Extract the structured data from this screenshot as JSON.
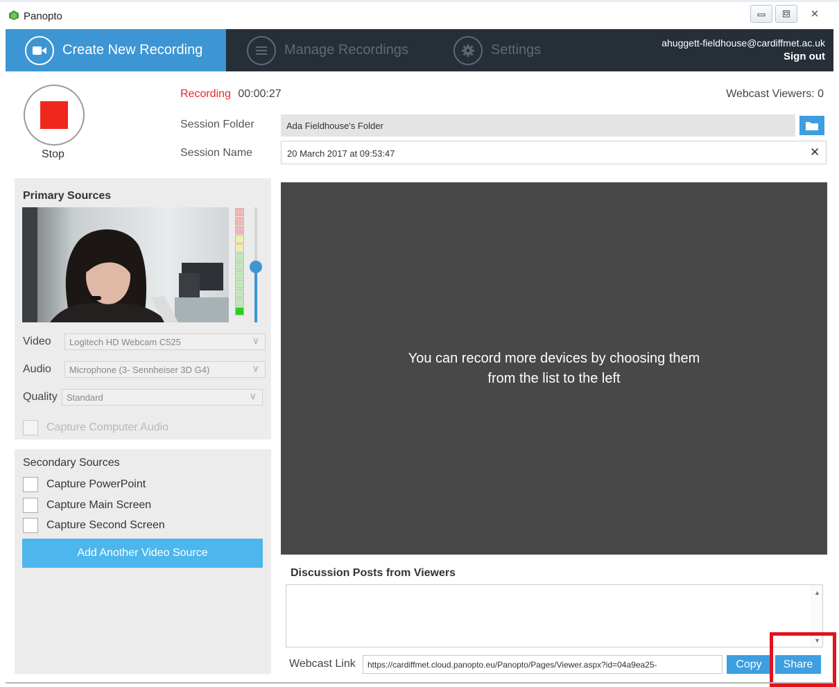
{
  "window": {
    "title": "Panopto",
    "controls": {
      "minimize": "minimize",
      "maximize": "maximize",
      "close": "✕"
    }
  },
  "nav": {
    "tabs": [
      {
        "label": "Create New Recording",
        "active": true
      },
      {
        "label": "Manage Recordings",
        "active": false
      },
      {
        "label": "Settings",
        "active": false
      }
    ],
    "user_email": "ahuggett-fieldhouse@cardiffmet.ac.uk",
    "sign_out": "Sign out"
  },
  "recording": {
    "stop_label": "Stop",
    "status_label": "Recording",
    "elapsed": "00:00:27",
    "webcast_viewers": "Webcast Viewers: 0",
    "session_folder_label": "Session Folder",
    "session_folder_value": "Ada Fieldhouse's Folder",
    "session_name_label": "Session Name",
    "session_name_value": "20 March 2017 at 09:53:47",
    "clear_glyph": "✕"
  },
  "primary": {
    "title": "Primary Sources",
    "video_label": "Video",
    "video_value": "Logitech HD Webcam C525",
    "audio_label": "Audio",
    "audio_value": "Microphone (3- Sennheiser 3D G4)",
    "quality_label": "Quality",
    "quality_value": "Standard",
    "capture_audio": "Capture Computer Audio",
    "audio_level_fraction": 0.1,
    "volume_fraction": 0.48
  },
  "secondary": {
    "title": "Secondary Sources",
    "options": [
      "Capture PowerPoint",
      "Capture Main Screen",
      "Capture Second Screen"
    ],
    "add_button": "Add Another Video Source"
  },
  "stage": {
    "message": "You can record more devices by choosing them from the list to the left"
  },
  "discussion": {
    "title": "Discussion Posts from Viewers",
    "webcast_link_label": "Webcast Link",
    "webcast_url": "https://cardiffmet.cloud.panopto.eu/Panopto/Pages/Viewer.aspx?id=04a9ea25-",
    "copy_button": "Copy",
    "share_button": "Share"
  },
  "colors": {
    "accent": "#3d95d3",
    "navbar": "#262f38",
    "record_red": "#f0281c",
    "highlight": "#e3121b"
  }
}
